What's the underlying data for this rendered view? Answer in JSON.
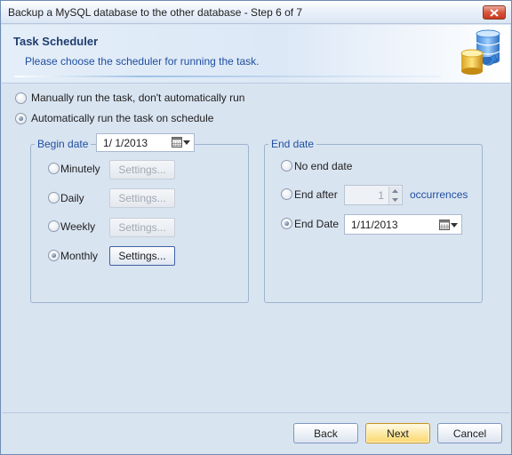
{
  "window": {
    "title": "Backup a MySQL database to the other database - Step 6 of 7"
  },
  "header": {
    "title": "Task Scheduler",
    "subtitle": "Please choose the scheduler for running the task."
  },
  "run_mode": {
    "manual_label": "Manually run the task, don't automatically run",
    "auto_label": "Automatically run the task on schedule",
    "selected": "auto"
  },
  "begin_date": {
    "legend": "Begin date",
    "value": "1/  1/2013",
    "frequencies": [
      {
        "label": "Minutely",
        "settings_label": "Settings...",
        "selected": false,
        "enabled": false
      },
      {
        "label": "Daily",
        "settings_label": "Settings...",
        "selected": false,
        "enabled": false
      },
      {
        "label": "Weekly",
        "settings_label": "Settings...",
        "selected": false,
        "enabled": false
      },
      {
        "label": "Monthly",
        "settings_label": "Settings...",
        "selected": true,
        "enabled": true
      }
    ]
  },
  "end_date": {
    "legend": "End date",
    "no_end_label": "No end date",
    "end_after_label": "End after",
    "occurrences_value": "1",
    "occurrences_label": "occurrences",
    "end_date_label": "End Date",
    "end_date_value": "1/11/2013",
    "selected": "end_date"
  },
  "footer": {
    "back_label": "Back",
    "next_label": "Next",
    "cancel_label": "Cancel"
  },
  "icons": {
    "close": "close-icon",
    "database": "database-icon",
    "calendar": "calendar-icon"
  }
}
